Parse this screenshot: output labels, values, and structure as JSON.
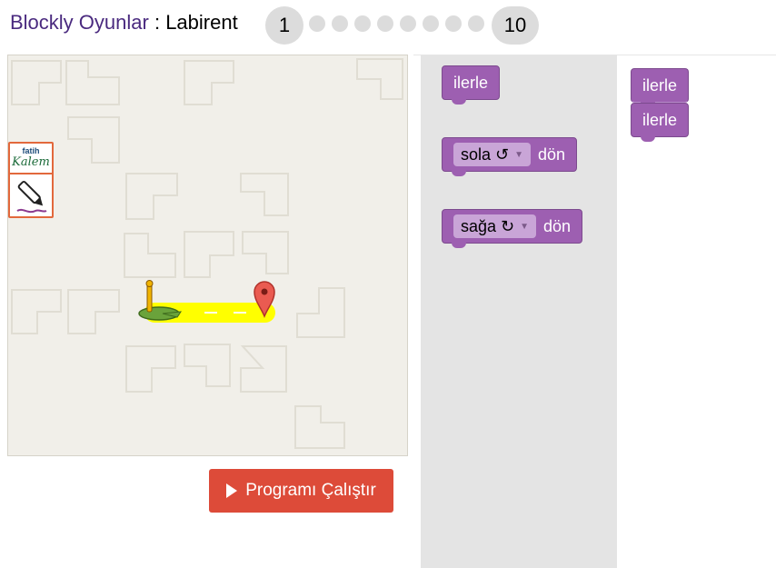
{
  "header": {
    "brand": "Blockly Oyunlar",
    "separator": " : ",
    "page": "Labirent",
    "level_first": "1",
    "level_last": "10"
  },
  "logo": {
    "line1": "fatih",
    "line2": "Kalem"
  },
  "run_button": {
    "label": "Programı Çalıştır"
  },
  "toolbox": {
    "move_label": "ilerle",
    "turn_left": {
      "dropdown": "sola ↺",
      "suffix": "dön"
    },
    "turn_right": {
      "dropdown": "sağa ↻",
      "suffix": "dön"
    }
  },
  "workspace": {
    "blocks": [
      "ilerle",
      "ilerle"
    ]
  },
  "colors": {
    "block": "#9d5fb1",
    "run_button": "#dd4b39",
    "path": "#ffff00",
    "brand": "#4a2a7f"
  }
}
